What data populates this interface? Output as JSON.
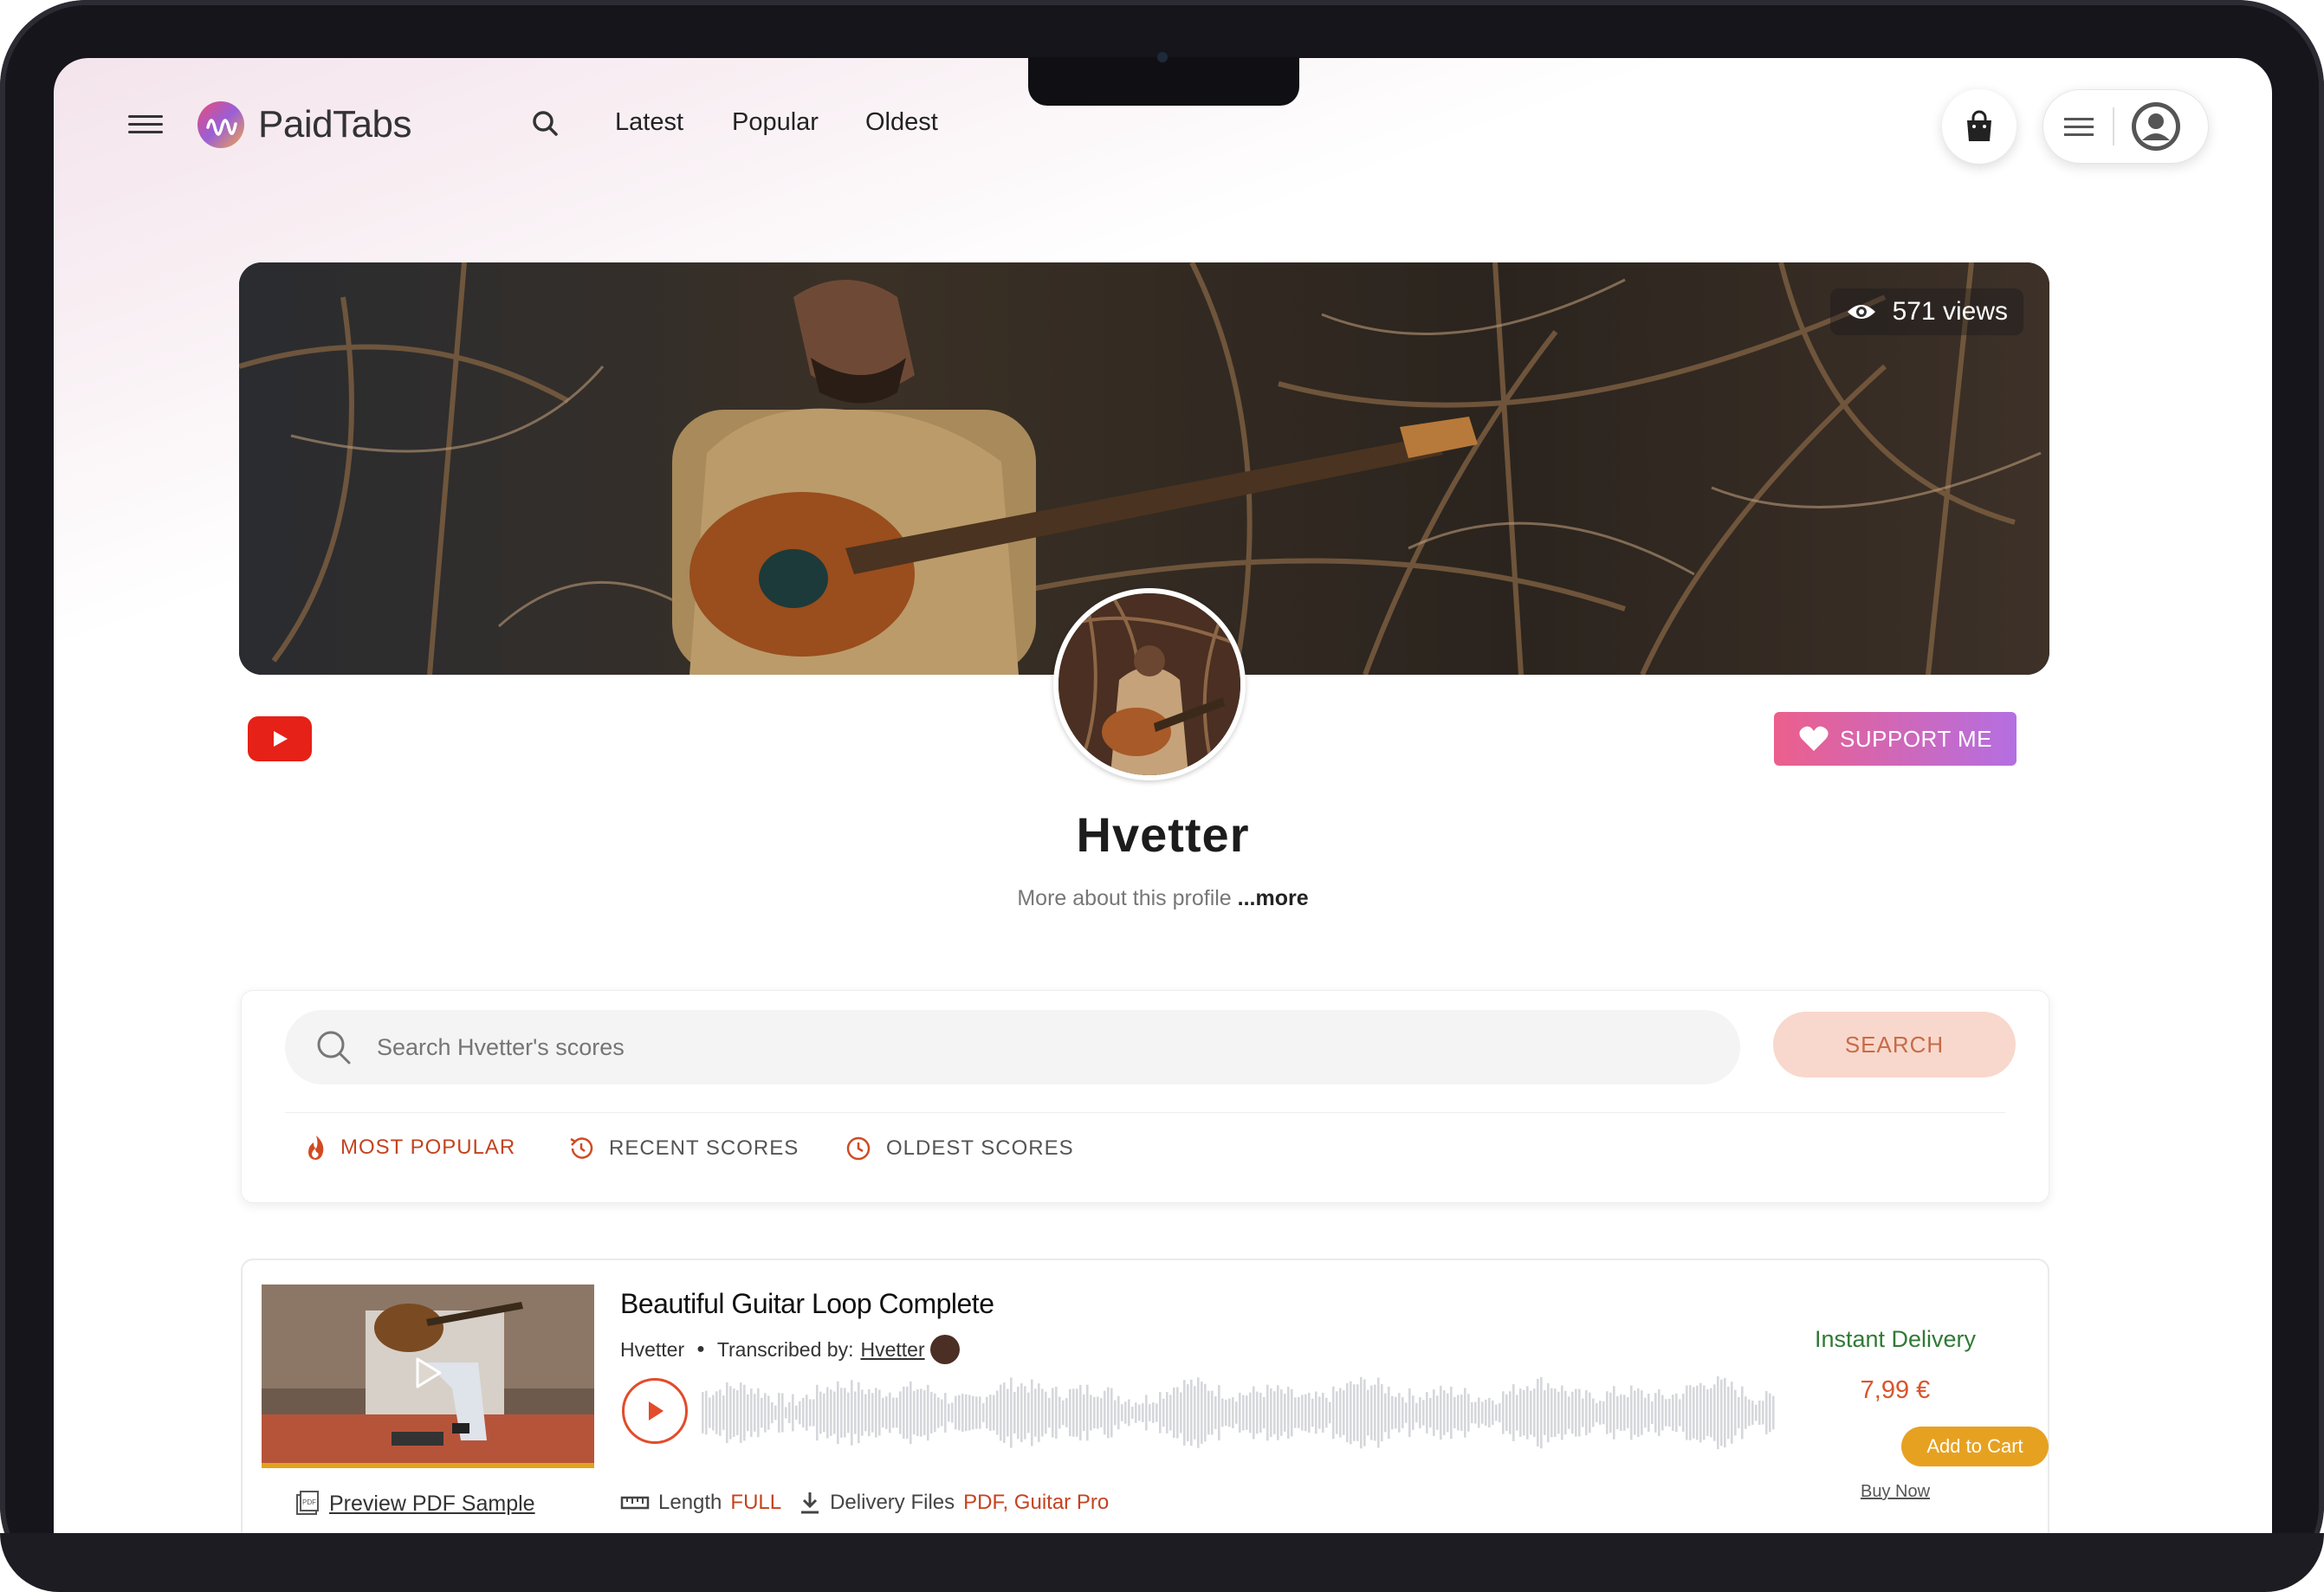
{
  "header": {
    "logo_text": "PaidTabs",
    "nav": [
      "Latest",
      "Popular",
      "Oldest"
    ]
  },
  "banner": {
    "views": "571 views"
  },
  "profile": {
    "name": "Hvetter",
    "more_prefix": "More about this profile ",
    "more_link": "...more",
    "support_label": "SUPPORT ME"
  },
  "search": {
    "placeholder": "Search Hvetter's scores",
    "button": "SEARCH",
    "tabs": [
      "MOST POPULAR",
      "RECENT SCORES",
      "OLDEST SCORES"
    ]
  },
  "scores": [
    {
      "title": "Beautiful Guitar Loop Complete",
      "artist": "Hvetter",
      "transcribed_label": "Transcribed by:",
      "transcriber": "Hvetter",
      "preview_label": "Preview PDF Sample",
      "length_label": "Length",
      "length_value": "FULL",
      "delivery_files_label": "Delivery Files",
      "delivery_files_value": "PDF, Guitar Pro",
      "delivery": "Instant Delivery",
      "price": "7,99 €",
      "add_to_cart": "Add to Cart",
      "buy_now": "Buy Now"
    }
  ],
  "colors": {
    "accent": "#c4431f",
    "support_gradient_start": "#ec5f8c",
    "support_gradient_end": "#b46fe2",
    "add_to_cart": "#e7a121",
    "delivery": "#2f7a34"
  },
  "icons": [
    "menu-icon",
    "paidtabs-logo-icon",
    "search-icon",
    "shopping-bag-icon",
    "hamburger-icon",
    "user-avatar-icon",
    "eye-icon",
    "youtube-icon",
    "heart-icon",
    "fire-icon",
    "history-icon",
    "clock-icon",
    "play-icon",
    "pdf-icon",
    "ruler-icon",
    "download-icon"
  ]
}
